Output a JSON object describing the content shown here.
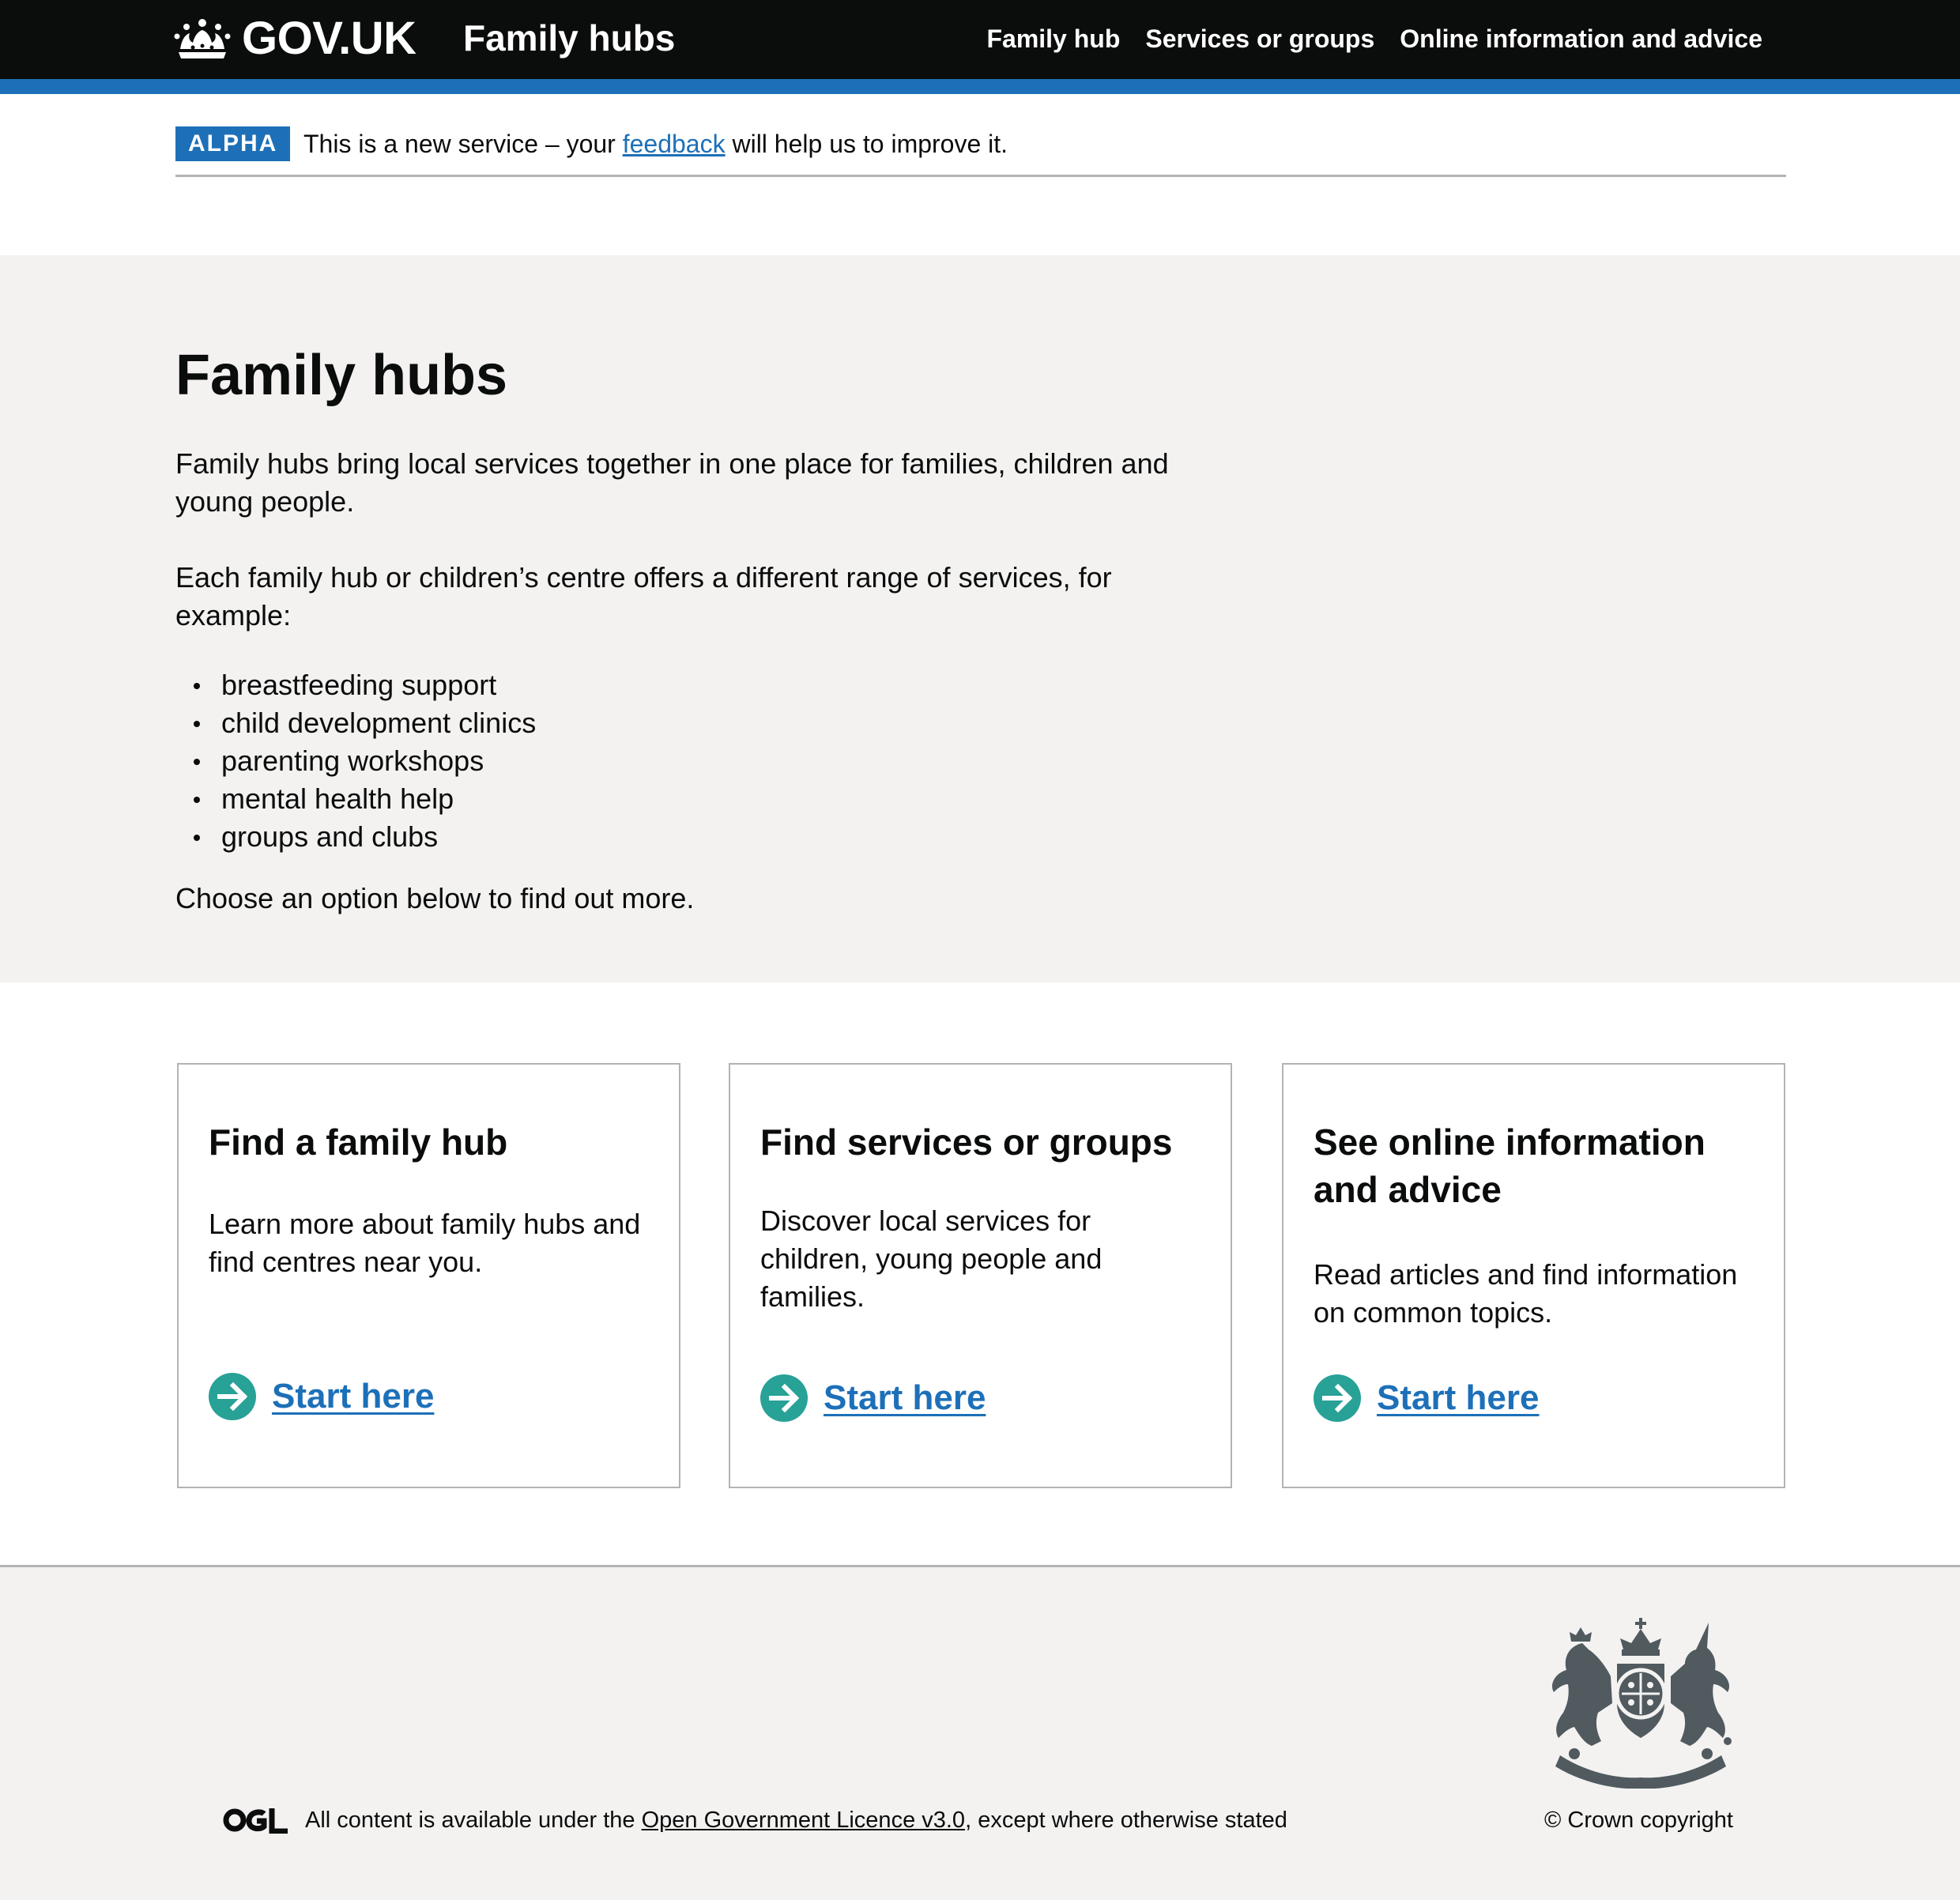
{
  "header": {
    "logo_text": "GOV.UK",
    "service_name": "Family hubs",
    "nav": [
      "Family hub",
      "Services or groups",
      "Online information and advice"
    ]
  },
  "phase_banner": {
    "tag": "ALPHA",
    "text_before": "This is a new service – your ",
    "link": "feedback",
    "text_after": " will help us to improve it."
  },
  "hero": {
    "title": "Family hubs",
    "para1": "Family hubs bring local services together in one place for families, children and young people.",
    "para2": "Each family hub or children’s centre offers a different range of services, for example:",
    "list": [
      "breastfeeding support",
      "child development clinics",
      "parenting workshops",
      "mental health help",
      "groups and clubs"
    ],
    "para3": "Choose an option below to find out more."
  },
  "cards": [
    {
      "title": "Find a family hub",
      "text": "Learn more about family hubs and find centres near you.",
      "link": "Start here"
    },
    {
      "title": "Find services or groups",
      "text": "Discover local services for children, young people and families.",
      "link": "Start here"
    },
    {
      "title": "See online information and advice",
      "text": "Read articles and find information on common topics.",
      "link": "Start here"
    }
  ],
  "footer": {
    "licence_before": "All content is available under the ",
    "licence_link": "Open Government Licence v3.0",
    "licence_after": ", except where otherwise stated",
    "copyright": "© Crown copyright"
  },
  "colors": {
    "header_bg": "#0b0c0c",
    "brand_blue": "#1d70b8",
    "arrow_green": "#28a197",
    "panel_grey": "#f3f2f1",
    "border_grey": "#b1b4b6"
  },
  "icons": [
    "crown-icon",
    "arrow-circle-icon",
    "ogl-icon",
    "royal-coat-of-arms-icon"
  ]
}
